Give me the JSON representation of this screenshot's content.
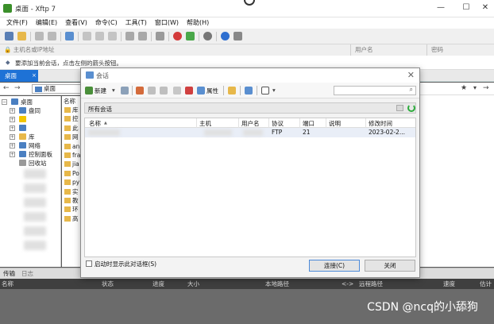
{
  "app": {
    "title": "桌面 - Xftp 7"
  },
  "menu": [
    "文件(F)",
    "编辑(E)",
    "查看(V)",
    "命令(C)",
    "工具(T)",
    "窗口(W)",
    "帮助(H)"
  ],
  "address": {
    "host_placeholder": "主机名或IP地址",
    "user_placeholder": "用户名",
    "pass_placeholder": "密码"
  },
  "hint": "要添加当前会话，点击左侧的箭头按钮。",
  "tab": {
    "label": "桌面",
    "close": "×"
  },
  "local_path": "桌面",
  "tree": [
    {
      "label": "桌面",
      "exp": "−",
      "color": "#4a7fc1",
      "indent": 0
    },
    {
      "label": "盘同",
      "exp": "+",
      "color": "#4a7fc1",
      "indent": 1
    },
    {
      "label": "",
      "exp": "+",
      "color": "#f2c600",
      "indent": 1
    },
    {
      "label": "",
      "exp": "+",
      "color": "#4a7fc1",
      "indent": 1
    },
    {
      "label": "库",
      "exp": "+",
      "color": "#e7b84a",
      "indent": 1
    },
    {
      "label": "网络",
      "exp": "+",
      "color": "#4a7fc1",
      "indent": 1
    },
    {
      "label": "控制面板",
      "exp": "+",
      "color": "#4a7fc1",
      "indent": 1
    },
    {
      "label": "回收站",
      "exp": "",
      "color": "#999999",
      "indent": 1
    }
  ],
  "files_header": "名称",
  "files": [
    "库",
    "控",
    "此",
    "网",
    "an",
    "fra",
    "jia",
    "Po",
    "py",
    "实",
    "教",
    "环",
    "高"
  ],
  "transfer": {
    "tabs": [
      "传输",
      "日志"
    ],
    "columns": [
      "名称",
      "状态",
      "进度",
      "大小",
      "本地路径",
      "<->",
      "远程路径",
      "速度",
      "估计"
    ]
  },
  "watermark": "CSDN @ncq的小舔狗",
  "dialog": {
    "title": "会话",
    "close": "✕",
    "toolbar": {
      "new_label": "新建",
      "props_label": "属性"
    },
    "folder": "所有会话",
    "columns": [
      "名称",
      "主机",
      "用户名",
      "协议",
      "端口",
      "说明",
      "修改时间"
    ],
    "sort_arrow": "▲",
    "row": {
      "protocol": "FTP",
      "port": "21",
      "note": "",
      "modified": "2023-02-2..."
    },
    "startup_label": "启动时显示此对话框(S)",
    "connect_label": "连接(C)",
    "close_label": "关闭"
  }
}
